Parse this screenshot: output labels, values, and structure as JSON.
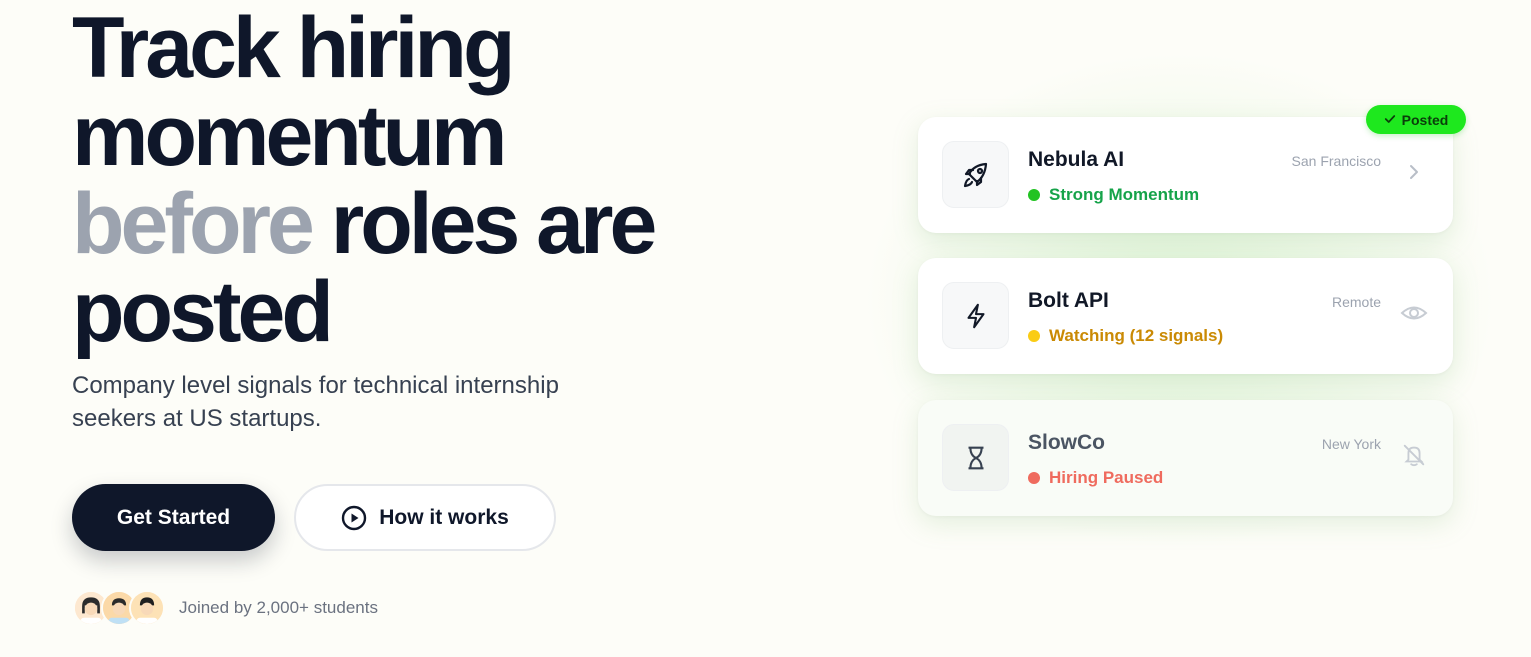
{
  "hero": {
    "headline_line1": "Track hiring",
    "headline_line2": "momentum",
    "headline_muted": "before",
    "headline_line3_rest": " roles are",
    "headline_line4": "posted",
    "subtitle": "Company level signals for technical internship seekers at US startups.",
    "primary_button": "Get Started",
    "secondary_button": "How it works",
    "social_proof": "Joined by 2,000+ students"
  },
  "badge": {
    "label": "Posted",
    "icon": "check-icon",
    "color": "#1ee81e"
  },
  "cards": [
    {
      "name": "Nebula AI",
      "location": "San Francisco",
      "status": "Strong Momentum",
      "status_color": "#16a34a",
      "dot_color": "#22c322",
      "icon": "rocket-icon",
      "action_icon": "chevron-right-icon"
    },
    {
      "name": "Bolt API",
      "location": "Remote",
      "status": "Watching (12 signals)",
      "status_color": "#ca8a04",
      "dot_color": "#facc15",
      "icon": "bolt-icon",
      "action_icon": "eye-icon"
    },
    {
      "name": "SlowCo",
      "location": "New York",
      "status": "Hiring Paused",
      "status_color": "#ef6b5e",
      "dot_color": "#ef6b5e",
      "icon": "hourglass-icon",
      "action_icon": "bell-off-icon"
    }
  ],
  "colors": {
    "primary": "#0f172a",
    "muted_headline": "#9ca3af",
    "background": "#fdfdf8"
  }
}
